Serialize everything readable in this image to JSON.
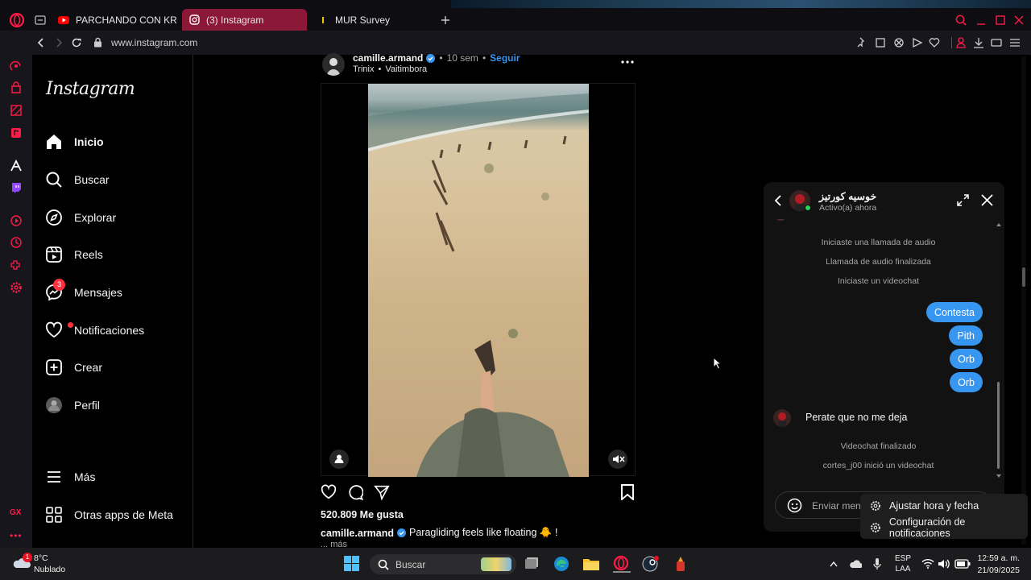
{
  "browser": {
    "tabs": [
      {
        "label": "PARCHANDO CON KRIS R",
        "icon": "youtube-icon",
        "active": false
      },
      {
        "label": "(3) Instagram",
        "icon": "instagram-icon",
        "active": true
      },
      {
        "label": "MUR Survey",
        "icon": "survey-icon",
        "active": false
      }
    ],
    "url": "www.instagram.com"
  },
  "instagram": {
    "logo": "Instagram",
    "nav": [
      {
        "label": "Inicio",
        "icon": "home-icon"
      },
      {
        "label": "Buscar",
        "icon": "search-icon"
      },
      {
        "label": "Explorar",
        "icon": "compass-icon"
      },
      {
        "label": "Reels",
        "icon": "reels-icon"
      },
      {
        "label": "Mensajes",
        "icon": "messenger-icon",
        "badge": "3"
      },
      {
        "label": "Notificaciones",
        "icon": "heart-icon"
      },
      {
        "label": "Crear",
        "icon": "create-icon"
      },
      {
        "label": "Perfil",
        "icon": "avatar-icon"
      }
    ],
    "more": "Más",
    "meta_apps": "Otras apps de Meta"
  },
  "post": {
    "username": "camille.armand",
    "time": "10 sem",
    "follow": "Seguir",
    "audio": "Trinix",
    "audio_sep": "•",
    "song": "Vaitimbora",
    "likes": "520.809 Me gusta",
    "caption_user": "camille.armand",
    "caption_text": "Paragliding feels like floating 🐥 !",
    "more": "... más"
  },
  "dm": {
    "name": "خوسیه کورتیز",
    "status": "Activo(a) ahora",
    "system_messages": [
      "Iniciaste una llamada de audio",
      "Llamada de audio finalizada",
      "Iniciaste un videochat"
    ],
    "sent": [
      "Contesta",
      "Pith",
      "Orb",
      "Orb"
    ],
    "received": "Perate que no me deja",
    "after_messages": [
      "Videochat finalizado",
      "cortes_j00 inició un videochat"
    ],
    "input_placeholder": "Enviar mens"
  },
  "context_menu": {
    "items": [
      "Ajustar hora y fecha",
      "Configuración de notificaciones"
    ]
  },
  "taskbar": {
    "weather_temp": "8°C",
    "weather_desc": "Nublado",
    "weather_badge": "1",
    "search_placeholder": "Buscar",
    "lang_top": "ESP",
    "lang_bottom": "LAA",
    "time": "12:59 a. m.",
    "date": "21/09/2025"
  },
  "colors": {
    "accent": "#3797f0",
    "opera_red": "#ff1b48",
    "active_tab": "#8b1837"
  }
}
